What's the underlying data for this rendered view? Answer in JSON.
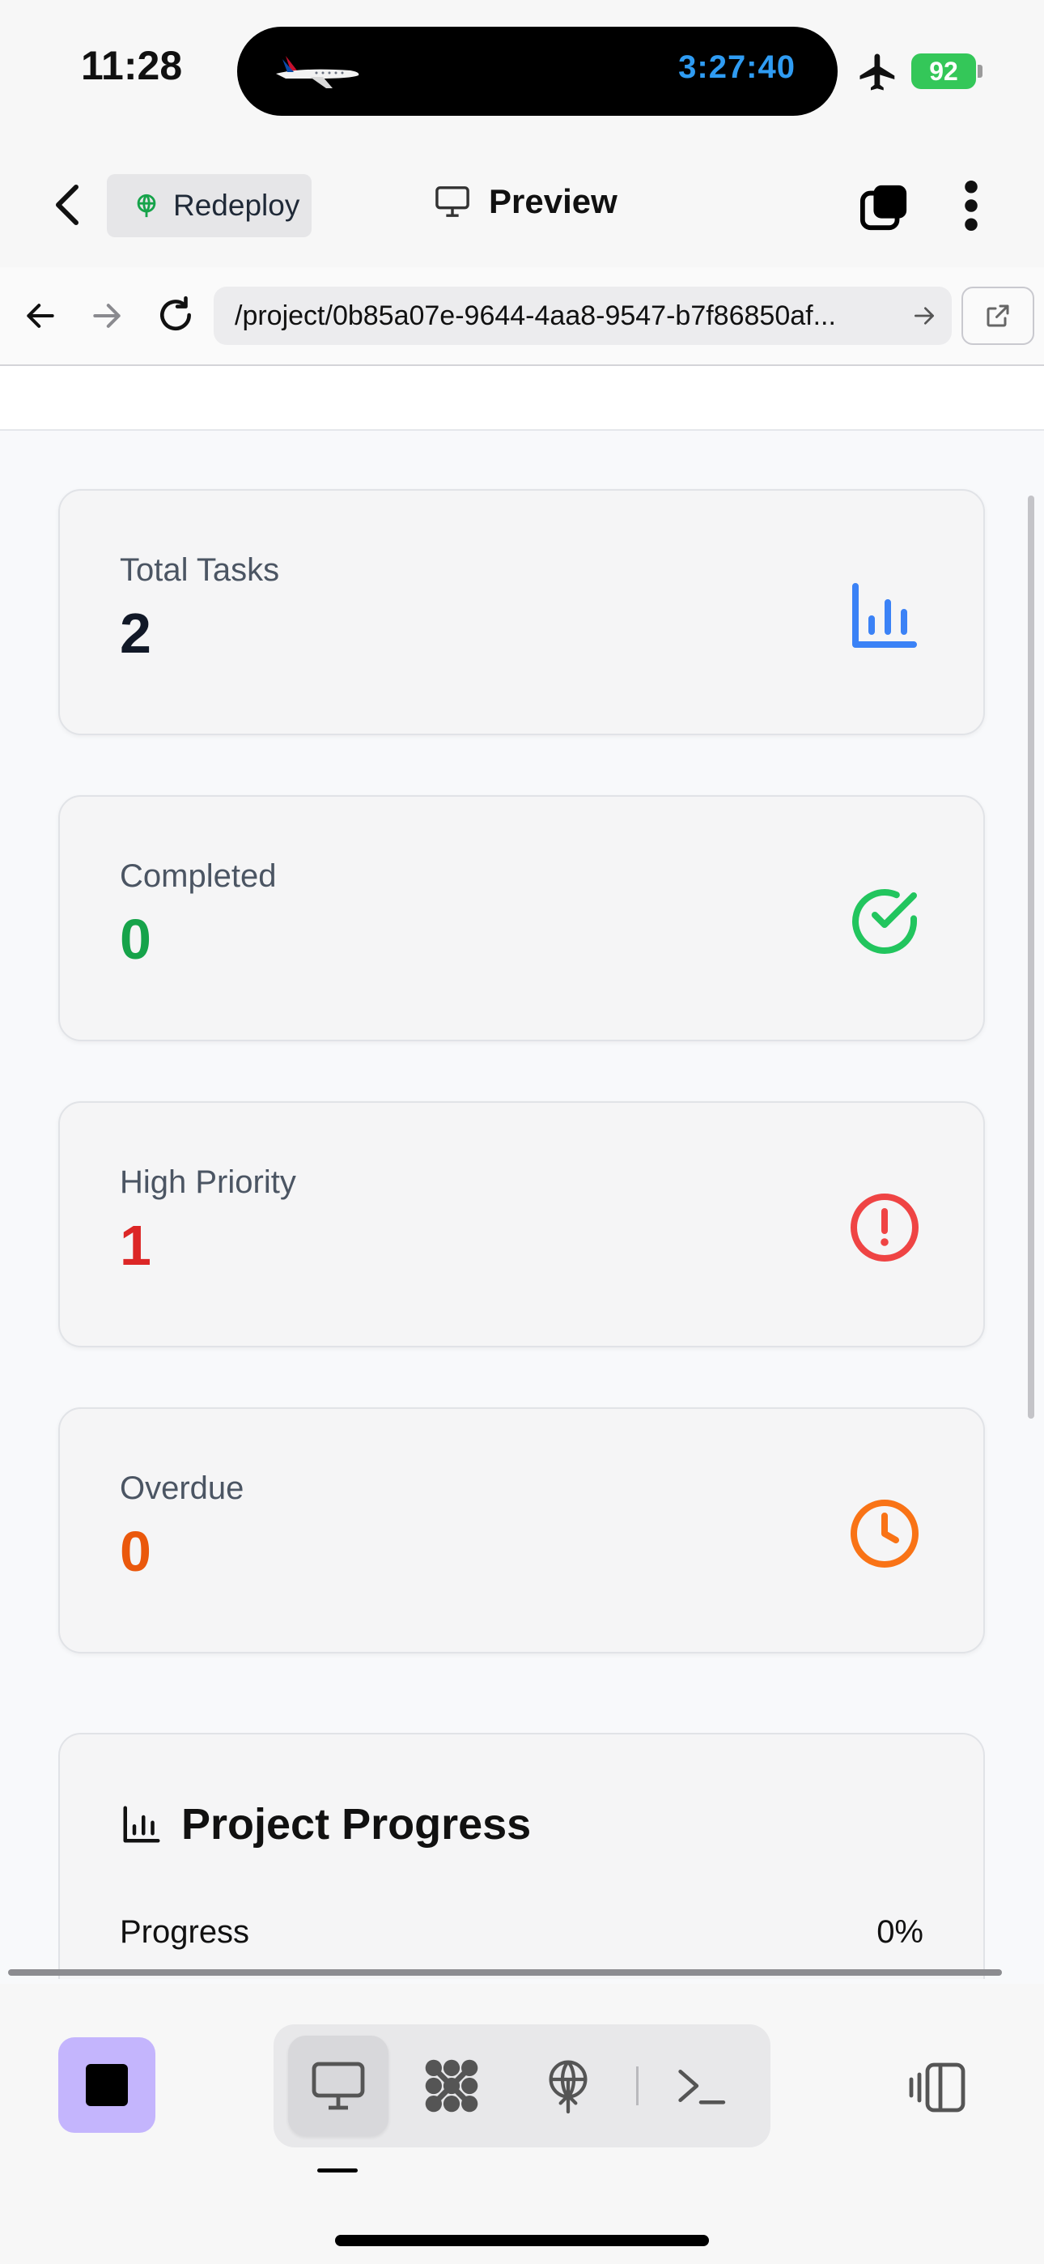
{
  "status_bar": {
    "time": "11:28",
    "live_activity_timer": "3:27:40",
    "battery_level": "92",
    "icons": [
      "american-airlines-plane-icon",
      "airplane-mode-icon",
      "battery-icon"
    ]
  },
  "header": {
    "redeploy_label": "Redeploy",
    "title": "Preview",
    "icons": [
      "back-chevron-icon",
      "globe-deploy-icon",
      "monitor-icon",
      "tabs-icon",
      "more-vertical-icon"
    ]
  },
  "url_bar": {
    "url": "/project/0b85a07e-9644-4aa8-9547-b7f86850af..."
  },
  "stats": [
    {
      "label": "Total Tasks",
      "value": "2",
      "color": "#111827",
      "icon": "bar-chart-icon",
      "icon_color": "#3b82f6"
    },
    {
      "label": "Completed",
      "value": "0",
      "color": "#16a34a",
      "icon": "check-circle-icon",
      "icon_color": "#22c55e"
    },
    {
      "label": "High Priority",
      "value": "1",
      "color": "#dc2626",
      "icon": "alert-circle-icon",
      "icon_color": "#ef4444"
    },
    {
      "label": "Overdue",
      "value": "0",
      "color": "#ea580c",
      "icon": "clock-icon",
      "icon_color": "#f97316"
    }
  ],
  "progress": {
    "title": "Project Progress",
    "label": "Progress",
    "value": "0%",
    "fraction": 0
  },
  "bottom_bar": {
    "modes": [
      "preview-monitor-icon",
      "workflow-icon",
      "deploy-globe-icon",
      "console-icon"
    ],
    "active_mode": "preview",
    "accent": "#c4b5fd"
  }
}
